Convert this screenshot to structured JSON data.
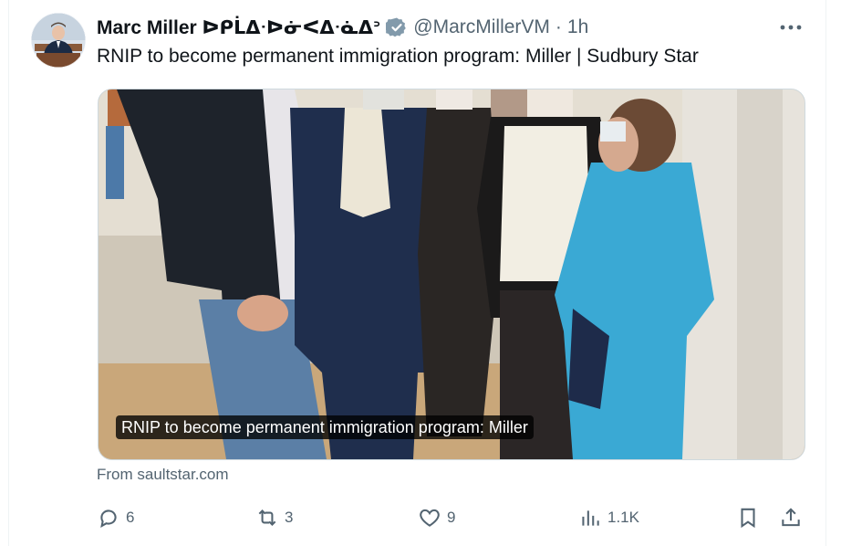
{
  "author": {
    "name": "Marc Miller ᐅᑭᒫᐃᐧᐅᓃᐸᐃᐧᓈᐃᐣ",
    "handle": "@MarcMillerVM",
    "separator": "·",
    "time": "1h",
    "verified": true
  },
  "tweet_text": "RNIP to become permanent immigration program: Miller | Sudbury Star",
  "media": {
    "caption": "RNIP to become permanent immigration program: Miller"
  },
  "link_source": "From saultstar.com",
  "actions": {
    "reply_count": "6",
    "retweet_count": "3",
    "like_count": "9",
    "views_count": "1.1K"
  },
  "icons": {
    "more": "more-horizontal-icon",
    "reply": "reply-icon",
    "retweet": "retweet-icon",
    "like": "heart-icon",
    "views": "views-icon",
    "bookmark": "bookmark-icon",
    "share": "share-icon",
    "verified": "verified-badge-icon"
  },
  "colors": {
    "verified_badge": "#829aab",
    "secondary_text": "#536471",
    "primary_text": "#0f1419"
  }
}
